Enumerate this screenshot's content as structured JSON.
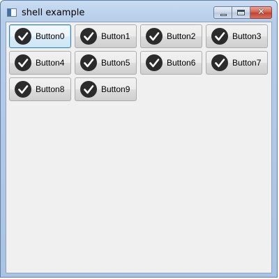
{
  "window": {
    "title": "shell example",
    "close_glyph": "✕"
  },
  "buttons": [
    {
      "label": "Button0",
      "focused": true
    },
    {
      "label": "Button1",
      "focused": false
    },
    {
      "label": "Button2",
      "focused": false
    },
    {
      "label": "Button3",
      "focused": false
    },
    {
      "label": "Button4",
      "focused": false
    },
    {
      "label": "Button5",
      "focused": false
    },
    {
      "label": "Button6",
      "focused": false
    },
    {
      "label": "Button7",
      "focused": false
    },
    {
      "label": "Button8",
      "focused": false
    },
    {
      "label": "Button9",
      "focused": false
    }
  ],
  "icon": {
    "name": "check-circle-icon",
    "fill": "#2b2b2b",
    "mark": "#ffffff"
  }
}
